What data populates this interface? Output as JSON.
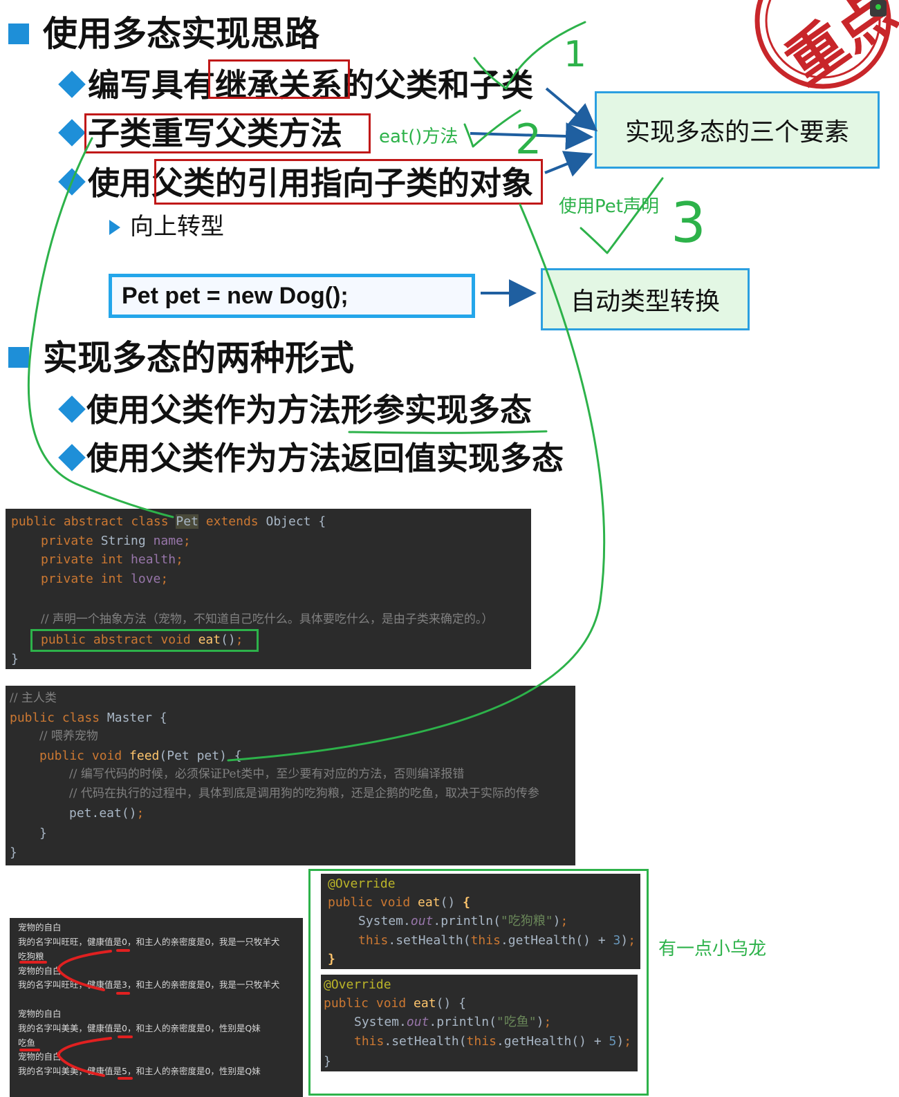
{
  "section1": {
    "title": "使用多态实现思路",
    "bullets": [
      "编写具有继承关系的父类和子类",
      "子类重写父类方法",
      "使用父类的引用指向子类的对象"
    ],
    "sub_bullet": "向上转型"
  },
  "notes": {
    "eat_method": "eat()方法",
    "use_pet": "使用Pet声明",
    "oolong": "有一点小乌龙",
    "num1": "1",
    "num2": "2",
    "num3": "3"
  },
  "callouts": {
    "three_elements": "实现多态的三个要素",
    "auto_cast": "自动类型转换"
  },
  "code_statement": "Pet pet = new Dog();",
  "stamp": "重点",
  "section2": {
    "title": "实现多态的两种形式",
    "bullets": [
      "使用父类作为方法形参实现多态",
      "使用父类作为方法返回值实现多态"
    ]
  },
  "code_pet": {
    "l1_kw": "public abstract class ",
    "l1_cls": "Pet",
    "l1_kw2": " extends ",
    "l1_rest": "Object {",
    "l2_kw": "private ",
    "l2_type": "String ",
    "l2_fld": "name",
    "l3_kw": "private int ",
    "l3_fld": "health",
    "l4_kw": "private int ",
    "l4_fld": "love",
    "comment": "// 声明一个抽象方法（宠物，不知道自己吃什么。具体要吃什么，是由子类来确定的。）",
    "l6_kw": "public abstract void ",
    "l6_fn": "eat",
    "l6_rest": "()",
    "semi": ";",
    "close": "}"
  },
  "code_master": {
    "c1": "// 主人类",
    "l2_kw": "public class ",
    "l2_rest": "Master {",
    "c3": "// 喂养宠物",
    "l4_kw": "public void ",
    "l4_fn": "feed",
    "l4_rest": "(Pet pet) {",
    "c5": "// 编写代码的时候，必须保证Pet类中，至少要有对应的方法，否则编译报错",
    "c6": "// 代码在执行的过程中，具体到底是调用狗的吃狗粮，还是企鹅的吃鱼，取决于实际的传参",
    "l7": "pet.eat()",
    "semi": ";",
    "close_inner": "}",
    "close": "}"
  },
  "console": [
    "宠物的自白",
    "我的名字叫旺旺，健康值是0，和主人的亲密度是0，我是一只牧羊犬",
    "吃狗粮",
    "宠物的自白",
    "我的名字叫旺旺，健康值是3，和主人的亲密度是0，我是一只牧羊犬",
    "宠物的自白",
    "我的名字叫美美，健康值是0，和主人的亲密度是0，性别是Q妹",
    "吃鱼",
    "宠物的自白",
    "我的名字叫美美，健康值是5，和主人的亲密度是0，性别是Q妹"
  ],
  "code_override1": {
    "ann": "@Override",
    "l2_kw": "public void ",
    "l2_fn": "eat",
    "l2_rest": "() ",
    "brace": "{",
    "l3_a": "System.",
    "l3_out": "out",
    "l3_b": ".println(",
    "l3_str": "\"吃狗粮\"",
    "l3_c": ")",
    "l4_this": "this",
    "l4_a": ".setHealth(",
    "l4_this2": "this",
    "l4_b": ".getHealth() + ",
    "l4_num": "3",
    "l4_c": ")",
    "semi": ";",
    "close": "}"
  },
  "code_override2": {
    "ann": "@Override",
    "l2_kw": "public void ",
    "l2_fn": "eat",
    "l2_rest": "() {",
    "l3_a": "System.",
    "l3_out": "out",
    "l3_b": ".println(",
    "l3_str": "\"吃鱼\"",
    "l3_c": ")",
    "l4_this": "this",
    "l4_a": ".setHealth(",
    "l4_this2": "this",
    "l4_b": ".getHealth() + ",
    "l4_num": "5",
    "l4_c": ")",
    "semi": ";",
    "close": "}"
  }
}
